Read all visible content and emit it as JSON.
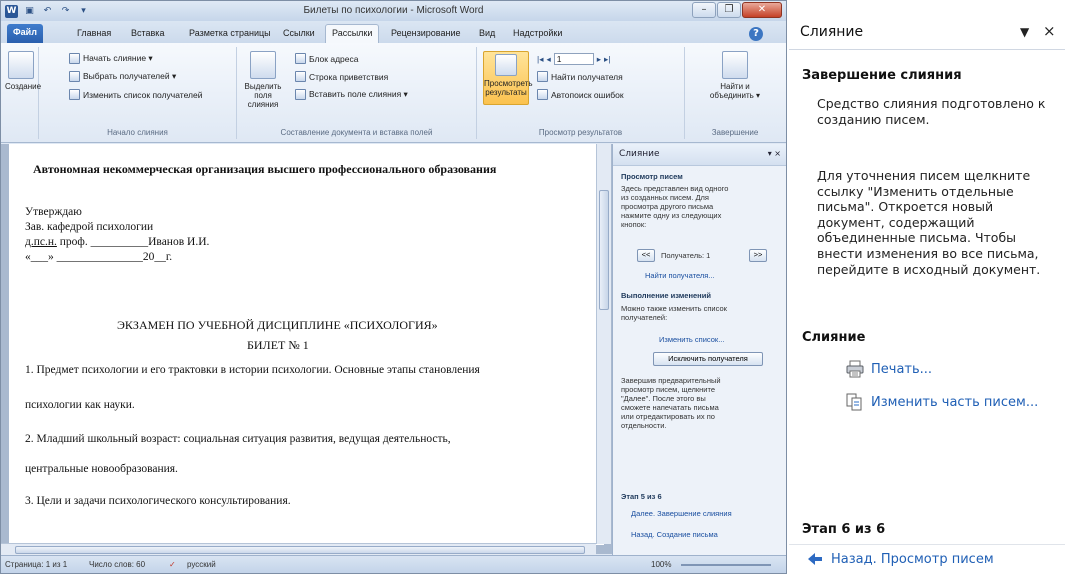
{
  "word": {
    "title": "Билеты по психологии - Microsoft Word",
    "qat": [
      "W",
      "▣",
      "↶",
      "↷",
      "▾"
    ],
    "window_controls": {
      "min": "–",
      "max": "❐",
      "close": "✕"
    },
    "tabs": [
      "Файл",
      "Главная",
      "Вставка",
      "Разметка страницы",
      "Ссылки",
      "Рассылки",
      "Рецензирование",
      "Вид",
      "Надстройки"
    ],
    "active_tab": "Рассылки",
    "ribbon": {
      "create_label": "Создание",
      "start_merge": "Начать слияние ▾",
      "select_recipients": "Выбрать получателей ▾",
      "edit_recipients": "Изменить список получателей",
      "group_start": "Начало слияния",
      "highlight_fields": "Выделить поля слияния",
      "address_block": "Блок адреса",
      "greeting_line": "Строка приветствия",
      "insert_field": "Вставить поле слияния ▾",
      "group_fields": "Составление документа и вставка полей",
      "preview_results": "Просмотреть результаты",
      "record_number": "1",
      "find_recipient": "Найти получателя",
      "auto_check": "Автопоиск ошибок",
      "group_preview": "Просмотр результатов",
      "finish_merge": "Найти и объединить ▾",
      "group_finish": "Завершение"
    },
    "document": {
      "org": "Автономная некоммерческая организация высшего профессионального образования",
      "approve": "Утверждаю",
      "head": "Зав. кафедрой психологии",
      "sign_prefix": "д.пс.н.",
      "sign_title": "проф. __________Иванов И.И.",
      "date_line": "«___» _______________20__г.",
      "exam_title": "ЭКЗАМЕН ПО УЧЕБНОЙ ДИСЦИПЛИНЕ «ПСИХОЛОГИЯ»",
      "ticket": "БИЛЕТ № 1",
      "q1a": "1. Предмет психологии и его трактовки в истории психологии. Основные этапы становления",
      "q1b": "психологии как науки.",
      "q2a": "2. Младший школьный возраст: социальная ситуация развития, ведущая деятельность,",
      "q2b": "центральные новообразования.",
      "q3": "3.  Цели и задачи психологического консультирования."
    },
    "mini_pane": {
      "title": "Слияние",
      "preview_title": "Просмотр писем",
      "preview_text": [
        "Здесь представлен вид одного",
        "из созданных писем. Для",
        "просмотра другого письма",
        "нажмите одну из следующих",
        "кнопок:"
      ],
      "recipient_label": "Получатель: 1",
      "prev": "<<",
      "next": ">>",
      "find_recipient": "Найти получателя...",
      "changes_title": "Выполнение изменений",
      "changes_text": [
        "Можно также изменить список",
        "получателей:"
      ],
      "edit_list": "Изменить список...",
      "exclude_btn": "Исключить получателя",
      "finish_text": [
        "Завершив предварительный",
        "просмотр писем, щелкните",
        "\"Далее\". После этого вы",
        "сможете напечатать письма",
        "или отредактировать их по",
        "отдельности."
      ],
      "step": "Этап 5 из 6",
      "next_link": "Далее. Завершение слияния",
      "back_link": "Назад. Создание письма"
    },
    "status": {
      "page": "Страница: 1 из 1",
      "words": "Число слов: 60",
      "lang": "русский",
      "zoom": "100%"
    }
  },
  "pane": {
    "title": "Слияние",
    "menu_icon": "▼",
    "close_icon": "×",
    "section1_title": "Завершение слияния",
    "para1": "Средство слияния подготовлено к созданию писем.",
    "para2": "Для уточнения писем щелкните ссылку \"Изменить отдельные письма\". Откроется новый документ, содержащий объединенные письма. Чтобы внести изменения во все письма, перейдите в исходный документ.",
    "section2_title": "Слияние",
    "print_link": "Печать...",
    "edit_link": "Изменить часть писем...",
    "step": "Этап 6 из 6",
    "back_link": "Назад. Просмотр писем"
  }
}
